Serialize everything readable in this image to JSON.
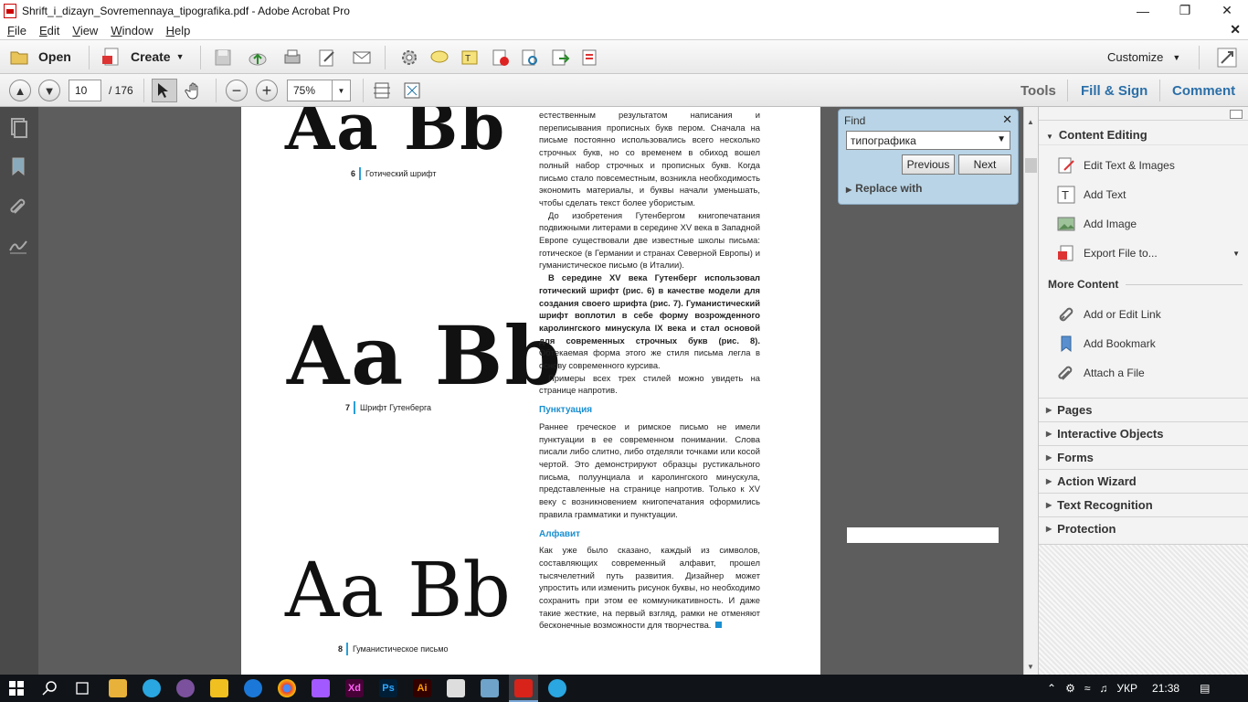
{
  "window": {
    "title": "Shrift_i_dizayn_Sovremennaya_tipografika.pdf - Adobe Acrobat Pro"
  },
  "menu": {
    "items": [
      "File",
      "Edit",
      "View",
      "Window",
      "Help"
    ]
  },
  "toolbar": {
    "open_label": "Open",
    "create_label": "Create",
    "customize_label": "Customize"
  },
  "nav": {
    "page_current": "10",
    "page_total": "/ 176",
    "zoom": "75%"
  },
  "tabs": {
    "tools": "Tools",
    "fill_sign": "Fill & Sign",
    "comment": "Comment"
  },
  "find": {
    "title": "Find",
    "query": "типографика",
    "prev_label": "Previous",
    "next_label": "Next",
    "replace_label": "Replace with"
  },
  "document": {
    "fig6_letters": "Aa Bb",
    "fig6_num": "6",
    "fig6_caption": "Готический шрифт",
    "fig7_letters": "Aa Bb",
    "fig7_num": "7",
    "fig7_caption": "Шрифт Гутенберга",
    "fig8_letters": "Aa Bb",
    "fig8_num": "8",
    "fig8_caption": "Гуманистическое письмо",
    "para1": "естественным результатом написания и переписывания прописных букв пером. Сначала на письме постоянно использовались всего несколько строчных букв, но со временем в обиход вошел полный набор строчных и прописных букв. Когда письмо стало повсеместным, возникла необходимость экономить материалы, и буквы начали уменьшать, чтобы сделать текст более убористым.",
    "para2": "До изобретения Гутенбергом книгопечатания подвижными литерами в середине XV века в Западной Европе существовали две известные школы письма: готическое (в Германии и странах Северной Европы) и гуманистическое письмо (в Италии).",
    "para3_bold": "В середине XV века Гутенберг использовал готический шрифт (рис. 6) в качестве модели для создания своего шрифта (рис. 7). Гуманистический шрифт воплотил в себе форму возрожденного каролингского минускула IX века и стал основой для современных строчных букв (рис. 8).",
    "para3_rest": " Обтекаемая форма этого же стиля письма легла в основу современного курсива.",
    "para4": "Примеры всех трех стилей можно увидеть на странице напротив.",
    "h_punct": "Пунктуация",
    "para5": "Раннее греческое и римское письмо не имели пунктуации в ее современном понимании. Слова писали либо слитно, либо отделяли точками или косой чертой. Это демонстрируют образцы рустикального письма, полуунциала и каролингского минускула, представленные на странице напротив. Только к XV веку с возникновением книгопечатания оформились правила грамматики и пунктуации.",
    "h_alpha": "Алфавит",
    "para6": "Как уже было сказано, каждый из символов, составляющих современный алфавит, прошел тысячелетний путь развития. Дизайнер может упростить или изменить рисунок буквы, но необходимо сохранить при этом ее коммуникативность. И даже такие жесткие, на первый взгляд, рамки не отменяют бесконечные возможности для творчества."
  },
  "right_panel": {
    "content_editing": "Content Editing",
    "edit_text_images": "Edit Text & Images",
    "add_text": "Add Text",
    "add_image": "Add Image",
    "export_file": "Export File to...",
    "more_content": "More Content",
    "add_link": "Add or Edit Link",
    "add_bookmark": "Add Bookmark",
    "attach_file": "Attach a File",
    "pages": "Pages",
    "interactive_objects": "Interactive Objects",
    "forms": "Forms",
    "action_wizard": "Action Wizard",
    "text_recognition": "Text Recognition",
    "protection": "Protection"
  },
  "taskbar": {
    "lang": "УКР",
    "time": "21:38"
  },
  "colors": {
    "accent": "#1b8fd0",
    "find_panel": "#b9d4e6",
    "doc_bg": "#5d5d5d"
  }
}
